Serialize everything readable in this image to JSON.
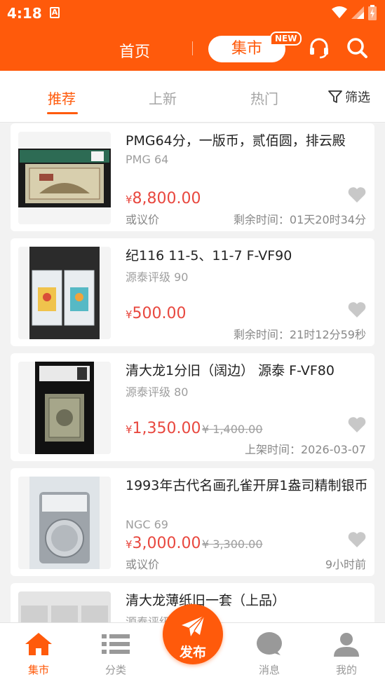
{
  "status": {
    "time": "4:18",
    "notification_letter": "A"
  },
  "header": {
    "home_label": "首页",
    "market_label": "集市",
    "new_badge": "NEW"
  },
  "tabs": {
    "items": [
      "推荐",
      "上新",
      "热门"
    ],
    "active": "推荐",
    "filter_label": "筛选"
  },
  "listings": [
    {
      "title": "PMG64分，一版币，贰佰圆，排云殿",
      "grade": "PMG 64",
      "currency": "¥",
      "price": "8,800.00",
      "original_price": "",
      "negotiable": "或议价",
      "meta": "剩余时间：01天20时34分"
    },
    {
      "title": "纪116 11-5、11-7 F-VF90",
      "grade": "源泰评级 90",
      "currency": "¥",
      "price": "500.00",
      "original_price": "",
      "negotiable": "",
      "meta": "剩余时间：21时12分59秒"
    },
    {
      "title": "清大龙1分旧（阔边） 源泰 F-VF80",
      "grade": "源泰评级 80",
      "currency": "¥",
      "price": "1,350.00",
      "original_price": "¥ 1,400.00",
      "negotiable": "",
      "meta": "上架时间：2026-03-07"
    },
    {
      "title": "1993年古代名画孔雀开屏1盎司精制银币",
      "grade": "NGC 69",
      "currency": "¥",
      "price": "3,000.00",
      "original_price": "¥ 3,300.00",
      "negotiable": "或议价",
      "meta": "9小时前"
    },
    {
      "title": "清大龙薄纸旧一套（上品）",
      "grade": "源泰评级",
      "currency": "¥",
      "price": "",
      "original_price": "",
      "negotiable": "",
      "meta": ""
    }
  ],
  "bottom_nav": {
    "market": "集市",
    "category": "分类",
    "publish": "发布",
    "messages": "消息",
    "mine": "我的"
  },
  "colors": {
    "brand": "#ff5a0b",
    "price": "#e8483f"
  }
}
